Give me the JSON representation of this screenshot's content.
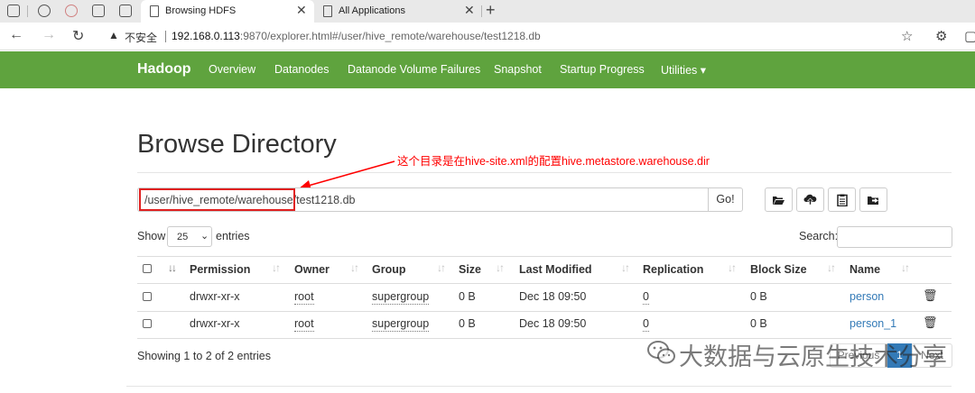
{
  "browser": {
    "tabs": [
      {
        "title": "Browsing HDFS",
        "active": true
      },
      {
        "title": "All Applications",
        "active": false
      }
    ],
    "security_label": "不安全",
    "url_host": "192.168.0.113",
    "url_rest": ":9870/explorer.html#/user/hive_remote/warehouse/test1218.db"
  },
  "navbar": {
    "brand": "Hadoop",
    "items": [
      "Overview",
      "Datanodes",
      "Datanode Volume Failures",
      "Snapshot",
      "Startup Progress",
      "Utilities"
    ],
    "utilities_caret": "▾",
    "color": "#5fa33e"
  },
  "page": {
    "title": "Browse Directory",
    "annotation": "这个目录是在hive-site.xml的配置hive.metastore.warehouse.dir",
    "annotation_color": "#ff0000",
    "path_value": "/user/hive_remote/warehouse/test1218.db",
    "go_label": "Go!"
  },
  "toolbar": {
    "icons": [
      "folder-open-icon",
      "upload-cloud-icon",
      "clipboard-icon",
      "move-folder-icon"
    ]
  },
  "length_menu": {
    "show_label": "Show",
    "value": "25",
    "entries_label": "entries"
  },
  "search": {
    "label": "Search:"
  },
  "table": {
    "columns": [
      "Permission",
      "Owner",
      "Group",
      "Size",
      "Last Modified",
      "Replication",
      "Block Size",
      "Name"
    ],
    "rows": [
      {
        "permission": "drwxr-xr-x",
        "owner": "root",
        "group": "supergroup",
        "size": "0 B",
        "last_modified": "Dec 18 09:50",
        "replication": "0",
        "block_size": "0 B",
        "name": "person"
      },
      {
        "permission": "drwxr-xr-x",
        "owner": "root",
        "group": "supergroup",
        "size": "0 B",
        "last_modified": "Dec 18 09:50",
        "replication": "0",
        "block_size": "0 B",
        "name": "person_1"
      }
    ]
  },
  "footer": {
    "showing": "Showing 1 to 2 of 2 entries",
    "pager_prev": "Previous",
    "pager_current": "1",
    "pager_next": "Next"
  },
  "watermark": {
    "text": "大数据与云原生技术分享"
  }
}
